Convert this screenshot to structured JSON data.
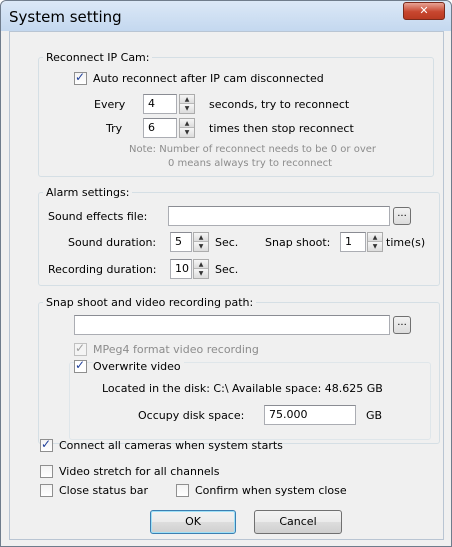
{
  "window": {
    "title": "System setting",
    "close_glyph": "✕"
  },
  "reconnect": {
    "legend": "Reconnect IP Cam:",
    "auto_label": "Auto reconnect after IP cam disconnected",
    "every_label": "Every",
    "every_value": "4",
    "every_suffix": "seconds, try to reconnect",
    "try_label": "Try",
    "try_value": "6",
    "try_suffix": "times then stop reconnect",
    "note_line1": "Note: Number of reconnect needs to be 0 or over",
    "note_line2": "0 means always try to reconnect"
  },
  "alarm": {
    "legend": "Alarm settings:",
    "sound_file_label": "Sound effects file:",
    "sound_file_value": "",
    "sound_duration_label": "Sound duration:",
    "sound_duration_value": "5",
    "sound_duration_unit": "Sec.",
    "snap_label": "Snap shoot:",
    "snap_value": "1",
    "snap_unit": "time(s)",
    "rec_duration_label": "Recording duration:",
    "rec_duration_value": "10",
    "rec_duration_unit": "Sec."
  },
  "path": {
    "legend": "Snap shoot and video recording path:",
    "path_value": "",
    "mpeg4_label": "MPeg4 format video recording",
    "overwrite_label": "Overwrite video",
    "disk_info": "Located in the disk: C:\\  Available space: 48.625 GB",
    "occupy_label": "Occupy disk space:",
    "occupy_value": "75.000",
    "occupy_unit": "GB"
  },
  "options": {
    "connect_all_label": "Connect all cameras when system starts",
    "video_stretch_label": "Video stretch for all channels",
    "close_status_label": "Close status bar",
    "confirm_close_label": "Confirm when system close"
  },
  "buttons": {
    "ok": "OK",
    "cancel": "Cancel",
    "browse": "..."
  },
  "spinner": {
    "up_glyph": "▲",
    "down_glyph": "▼"
  }
}
